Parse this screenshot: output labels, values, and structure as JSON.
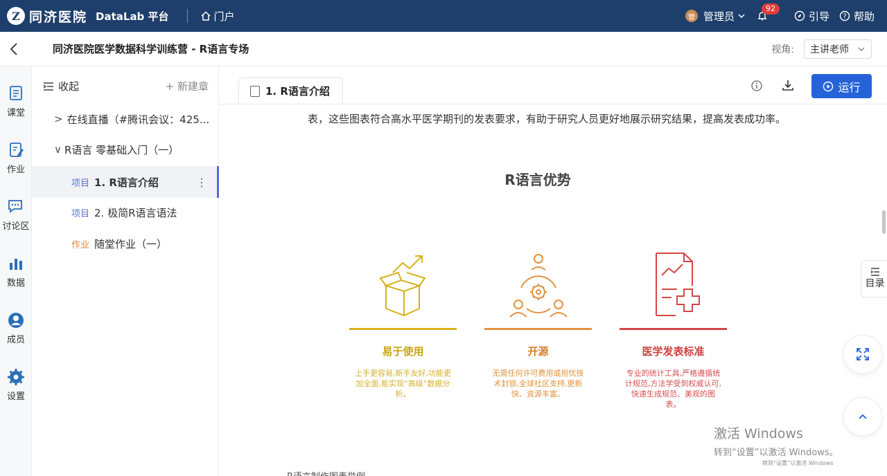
{
  "header": {
    "logo_mark": "Z",
    "logo_name": "同济医院",
    "platform": "DataLab 平台",
    "portal": "门户",
    "user_avatar": "管",
    "user": "管理员",
    "notifications": "92",
    "guide": "引导",
    "help": "帮助"
  },
  "subheader": {
    "course_title": "同济医院医学数据科学训练营 - R语言专场",
    "view_label": "视角:",
    "view_value": "主讲老师"
  },
  "rail": [
    {
      "label": "课堂",
      "icon": "classroom-icon"
    },
    {
      "label": "作业",
      "icon": "homework-icon"
    },
    {
      "label": "讨论区",
      "icon": "discussion-icon"
    },
    {
      "label": "数据",
      "icon": "data-icon"
    },
    {
      "label": "成员",
      "icon": "member-icon"
    },
    {
      "label": "设置",
      "icon": "settings-icon"
    }
  ],
  "chapters": {
    "collapse": "收起",
    "new_chapter": "+ 新建章",
    "rows": [
      {
        "prefix": ">",
        "title": "在线直播（#腾讯会议：425..."
      },
      {
        "prefix": "∨",
        "title": "R语言 零基础入门（一）"
      },
      {
        "tag": "项目",
        "title": "1. R语言介绍"
      },
      {
        "tag": "项目",
        "title": "2. 极简R语言语法"
      },
      {
        "tag": "作业",
        "title": "随堂作业（一）"
      }
    ]
  },
  "content": {
    "tab_title": "1. R语言介绍",
    "run": "运行",
    "paragraph": "表，这些图表符合高水平医学期刊的发表要求，有助于研究人员更好地展示研究结果，提高发表成功率。",
    "slide_title": "R语言优势",
    "cards": [
      {
        "title": "易于使用",
        "desc": "上手更容易,新手友好,功能更加全面,能实现“高级”数据分析。",
        "color": "#d6b21c"
      },
      {
        "title": "开源",
        "desc": "无需任何许可费用或担忧技术封锁,全球社区支持,更新快、资源丰富。",
        "color": "#e2923f"
      },
      {
        "title": "医学发表标准",
        "desc": "专业的统计工具,严格遵循统计规范,方法学受到权威认可,快速生成规范、美观的图表。",
        "color": "#d24747"
      }
    ],
    "footer": "R语言制作图表举例"
  },
  "side": {
    "toc": "目录"
  },
  "windows": {
    "line1": "激活 Windows",
    "line2": "转到“设置”以激活 Windows。",
    "line3": "转到“设置”以激活 Windows"
  },
  "colors": {
    "topbar": "#1e3f6b",
    "primary": "#2563d9",
    "accent": "#5a6bd6"
  }
}
